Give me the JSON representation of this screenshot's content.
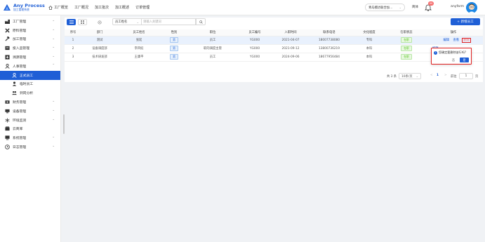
{
  "brand": {
    "title": "Any Process",
    "subtitle": "加工管理系统"
  },
  "topnav": [
    {
      "label": "工厂概览",
      "icon": "home-icon"
    },
    {
      "label": "工厂概况"
    },
    {
      "label": "加工批次"
    },
    {
      "label": "加工概述"
    },
    {
      "label": "订单管理"
    }
  ],
  "header": {
    "factory_select": "青岛模达联合加...",
    "language": "简体",
    "notification_count": "99",
    "username": "anyfarm"
  },
  "sidebar": {
    "items": [
      {
        "label": "工厂管理",
        "icon": "factory-icon",
        "chevron": "⌄"
      },
      {
        "label": "原料管理",
        "icon": "tools-cross-icon",
        "chevron": "⌄"
      },
      {
        "label": "加工管理",
        "icon": "hammer-icon",
        "chevron": "⌄"
      },
      {
        "label": "投入品管理",
        "icon": "box-icon",
        "chevron": "⌄"
      },
      {
        "label": "溯源管理",
        "icon": "trace-icon",
        "chevron": "⌄"
      },
      {
        "label": "人事管理",
        "icon": "person-icon",
        "chevron": "⌃"
      }
    ],
    "sub_items": [
      {
        "label": "正式员工",
        "icon": "user-icon",
        "active": true
      },
      {
        "label": "临时员工",
        "icon": "user-outline-icon",
        "active": false
      },
      {
        "label": "到岗分析",
        "icon": "users-icon",
        "active": false
      }
    ],
    "items_after": [
      {
        "label": "财务管理",
        "icon": "money-icon",
        "chevron": "⌄"
      },
      {
        "label": "设备管理",
        "icon": "device-icon",
        "chevron": "⌄"
      },
      {
        "label": "环境监测",
        "icon": "snowflake-icon",
        "chevron": "⌄"
      },
      {
        "label": "云商库",
        "icon": "cloud-shop-icon",
        "chevron": ""
      },
      {
        "label": "系统管理",
        "icon": "monitor-icon",
        "chevron": "⌄"
      },
      {
        "label": "日志管理",
        "icon": "clock-icon",
        "chevron": "⌄"
      }
    ]
  },
  "toolbar": {
    "filter_select": "员工姓名",
    "search_placeholder": "请输入关键词",
    "add_button": "+ 新增员工"
  },
  "table": {
    "columns": [
      "序号",
      "部门",
      "员工姓名",
      "性别",
      "职位",
      "员工编号",
      "入职时间",
      "联系电话",
      "文化程度",
      "在职状态",
      "操作"
    ],
    "rows": [
      {
        "no": "1",
        "dept": "测试",
        "name": "张延",
        "gender": "男",
        "position": "员工",
        "emp_no": "YG000",
        "join_date": "2021-04-07",
        "phone": "18007738080",
        "edu": "专科",
        "status": "在职",
        "selected": true
      },
      {
        "no": "2",
        "dept": "设备调度部",
        "name": "李四纪",
        "gender": "男",
        "position": "职的调度主管",
        "emp_no": "YG000",
        "join_date": "2021-09-12",
        "phone": "13800736219",
        "edu": "本科",
        "status": "在职",
        "selected": false
      },
      {
        "no": "3",
        "dept": "技术研发部",
        "name": "王康平",
        "gender": "男",
        "position": "员工",
        "emp_no": "YG000",
        "join_date": "2024-09-06",
        "phone": "18677956484",
        "edu": "本科",
        "status": "在职",
        "selected": false
      }
    ],
    "actions": {
      "edit": "编辑",
      "detail": "查看",
      "delete": "删除"
    }
  },
  "pager": {
    "total_text": "共 3 条",
    "page_size": "10条/页",
    "prev": "<",
    "current_page": "1",
    "next": ">",
    "goto_label": "前往",
    "goto_value": "1",
    "page_suffix": "页"
  },
  "popconfirm": {
    "message": "您确定要删除该行吗?",
    "cancel": "否",
    "confirm": "是"
  },
  "colors": {
    "primary": "#1f5fd6",
    "danger": "#e02020",
    "success": "#52c41a"
  }
}
